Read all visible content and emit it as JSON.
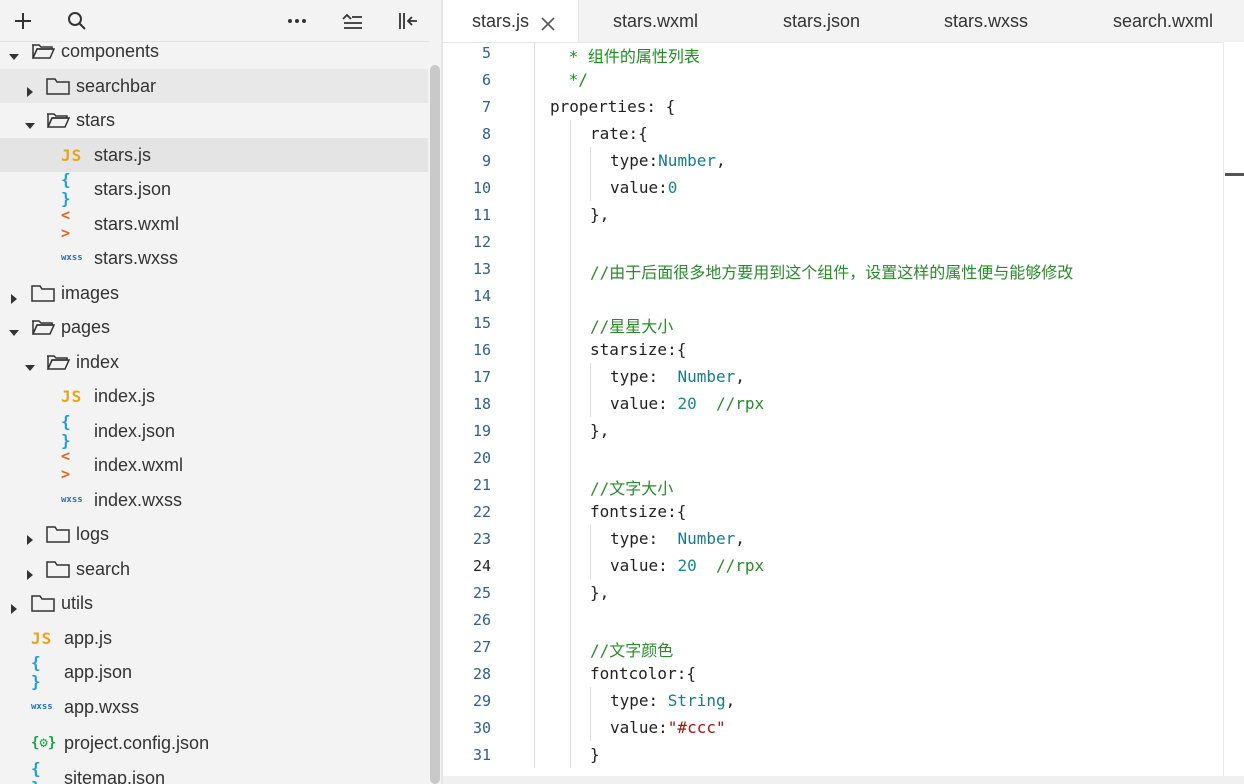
{
  "toolbar": {
    "icons": [
      "add-icon",
      "search-icon",
      "more-icon",
      "collapse-all-icon",
      "hide-sidebar-icon"
    ]
  },
  "tree": {
    "items": [
      {
        "label": "components",
        "kind": "folder",
        "expanded": true,
        "state": ""
      },
      {
        "label": "searchbar",
        "kind": "folder",
        "expanded": false,
        "state": "hover"
      },
      {
        "label": "stars",
        "kind": "folder",
        "expanded": true,
        "state": ""
      },
      {
        "label": "stars.js",
        "kind": "js",
        "badge": "JS",
        "state": "selected"
      },
      {
        "label": "stars.json",
        "kind": "json",
        "badge": "{ }",
        "state": ""
      },
      {
        "label": "stars.wxml",
        "kind": "wxml",
        "badge": "< >",
        "state": ""
      },
      {
        "label": "stars.wxss",
        "kind": "wxss",
        "badge": "wxss",
        "state": ""
      },
      {
        "label": "images",
        "kind": "folder",
        "expanded": false,
        "state": ""
      },
      {
        "label": "pages",
        "kind": "folder",
        "expanded": true,
        "state": ""
      },
      {
        "label": "index",
        "kind": "folder",
        "expanded": true,
        "state": ""
      },
      {
        "label": "index.js",
        "kind": "js",
        "badge": "JS",
        "state": ""
      },
      {
        "label": "index.json",
        "kind": "json",
        "badge": "{ }",
        "state": ""
      },
      {
        "label": "index.wxml",
        "kind": "wxml",
        "badge": "< >",
        "state": ""
      },
      {
        "label": "index.wxss",
        "kind": "wxss",
        "badge": "wxss",
        "state": ""
      },
      {
        "label": "logs",
        "kind": "folder",
        "expanded": false,
        "state": ""
      },
      {
        "label": "search",
        "kind": "folder",
        "expanded": false,
        "state": ""
      },
      {
        "label": "utils",
        "kind": "folder",
        "expanded": false,
        "state": ""
      },
      {
        "label": "app.js",
        "kind": "js",
        "badge": "JS",
        "state": ""
      },
      {
        "label": "app.json",
        "kind": "json",
        "badge": "{ }",
        "state": ""
      },
      {
        "label": "app.wxss",
        "kind": "wxss",
        "badge": "wxss",
        "state": ""
      },
      {
        "label": "project.config.json",
        "kind": "config",
        "badge": "{⚙}",
        "state": ""
      },
      {
        "label": "sitemap.json",
        "kind": "json",
        "badge": "{ }",
        "state": ""
      }
    ]
  },
  "tabs": [
    {
      "label": "stars.js",
      "active": true
    },
    {
      "label": "stars.wxml",
      "active": false
    },
    {
      "label": "stars.json",
      "active": false
    },
    {
      "label": "stars.wxss",
      "active": false
    },
    {
      "label": "search.wxml",
      "active": false
    }
  ],
  "editor": {
    "current_line": "24",
    "lines": [
      {
        "n": "5",
        "tokens": [
          [
            " * 组件的属性列表",
            "cm"
          ]
        ]
      },
      {
        "n": "6",
        "tokens": [
          [
            " */",
            "cm"
          ]
        ]
      },
      {
        "n": "7",
        "tokens": [
          [
            "properties: {",
            ""
          ]
        ]
      },
      {
        "n": "8",
        "tokens": [
          [
            "rate:{",
            ""
          ]
        ]
      },
      {
        "n": "9",
        "tokens": [
          [
            "type:",
            ""
          ],
          [
            "Number",
            "type"
          ],
          [
            ",",
            ""
          ]
        ]
      },
      {
        "n": "10",
        "tokens": [
          [
            "value:",
            ""
          ],
          [
            "0",
            "num"
          ]
        ]
      },
      {
        "n": "11",
        "tokens": [
          [
            "},",
            ""
          ]
        ]
      },
      {
        "n": "12",
        "tokens": []
      },
      {
        "n": "13",
        "tokens": [
          [
            "//由于后面很多地方要用到这个组件，设置这样的属性便与能够修改",
            "cmt"
          ]
        ]
      },
      {
        "n": "14",
        "tokens": []
      },
      {
        "n": "15",
        "tokens": [
          [
            "//星星大小",
            "cmt"
          ]
        ]
      },
      {
        "n": "16",
        "tokens": [
          [
            "starsize:{",
            ""
          ]
        ]
      },
      {
        "n": "17",
        "tokens": [
          [
            "type:  ",
            ""
          ],
          [
            "Number",
            "type"
          ],
          [
            ",",
            ""
          ]
        ]
      },
      {
        "n": "18",
        "tokens": [
          [
            "value: ",
            ""
          ],
          [
            "20",
            "num"
          ],
          [
            "  ",
            ""
          ],
          [
            "//rpx",
            "cmt"
          ]
        ]
      },
      {
        "n": "19",
        "tokens": [
          [
            "},",
            ""
          ]
        ]
      },
      {
        "n": "20",
        "tokens": []
      },
      {
        "n": "21",
        "tokens": [
          [
            "//文字大小",
            "cmt"
          ]
        ]
      },
      {
        "n": "22",
        "tokens": [
          [
            "fontsize:{",
            ""
          ]
        ]
      },
      {
        "n": "23",
        "tokens": [
          [
            "type:  ",
            ""
          ],
          [
            "Number",
            "type"
          ],
          [
            ",",
            ""
          ]
        ]
      },
      {
        "n": "24",
        "tokens": [
          [
            "value: ",
            ""
          ],
          [
            "20",
            "num"
          ],
          [
            "  ",
            ""
          ],
          [
            "//rpx",
            "cmt"
          ]
        ]
      },
      {
        "n": "25",
        "tokens": [
          [
            "},",
            ""
          ]
        ]
      },
      {
        "n": "26",
        "tokens": []
      },
      {
        "n": "27",
        "tokens": [
          [
            "//文字颜色",
            "cmt"
          ]
        ]
      },
      {
        "n": "28",
        "tokens": [
          [
            "fontcolor:{",
            ""
          ]
        ]
      },
      {
        "n": "29",
        "tokens": [
          [
            "type: ",
            ""
          ],
          [
            "String",
            "type"
          ],
          [
            ",",
            ""
          ]
        ]
      },
      {
        "n": "30",
        "tokens": [
          [
            "value:",
            ""
          ],
          [
            "\"#ccc\"",
            "str"
          ]
        ]
      },
      {
        "n": "31",
        "tokens": [
          [
            "}",
            ""
          ]
        ]
      }
    ]
  },
  "colors": {
    "comment": "#1a8f1a",
    "number": "#1a8a8a",
    "type": "#1a7a8a",
    "string": "#a31515",
    "js_icon": "#e8a51a",
    "json_icon": "#1f9fd6",
    "wxml_icon": "#e2661f",
    "wxss_icon": "#2a6fb5",
    "config_icon": "#1aa34a"
  }
}
